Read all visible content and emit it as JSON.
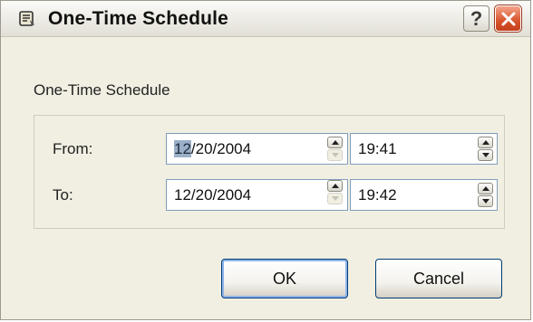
{
  "window": {
    "title": "One-Time Schedule",
    "help_glyph": "?"
  },
  "schedule": {
    "group_label": "One-Time Schedule",
    "from": {
      "label": "From:",
      "date_selected": "12",
      "date_rest": "/20/2004",
      "time": "19:41"
    },
    "to": {
      "label": "To:",
      "date": "12/20/2004",
      "time": "19:42"
    }
  },
  "buttons": {
    "ok": "OK",
    "cancel": "Cancel"
  }
}
